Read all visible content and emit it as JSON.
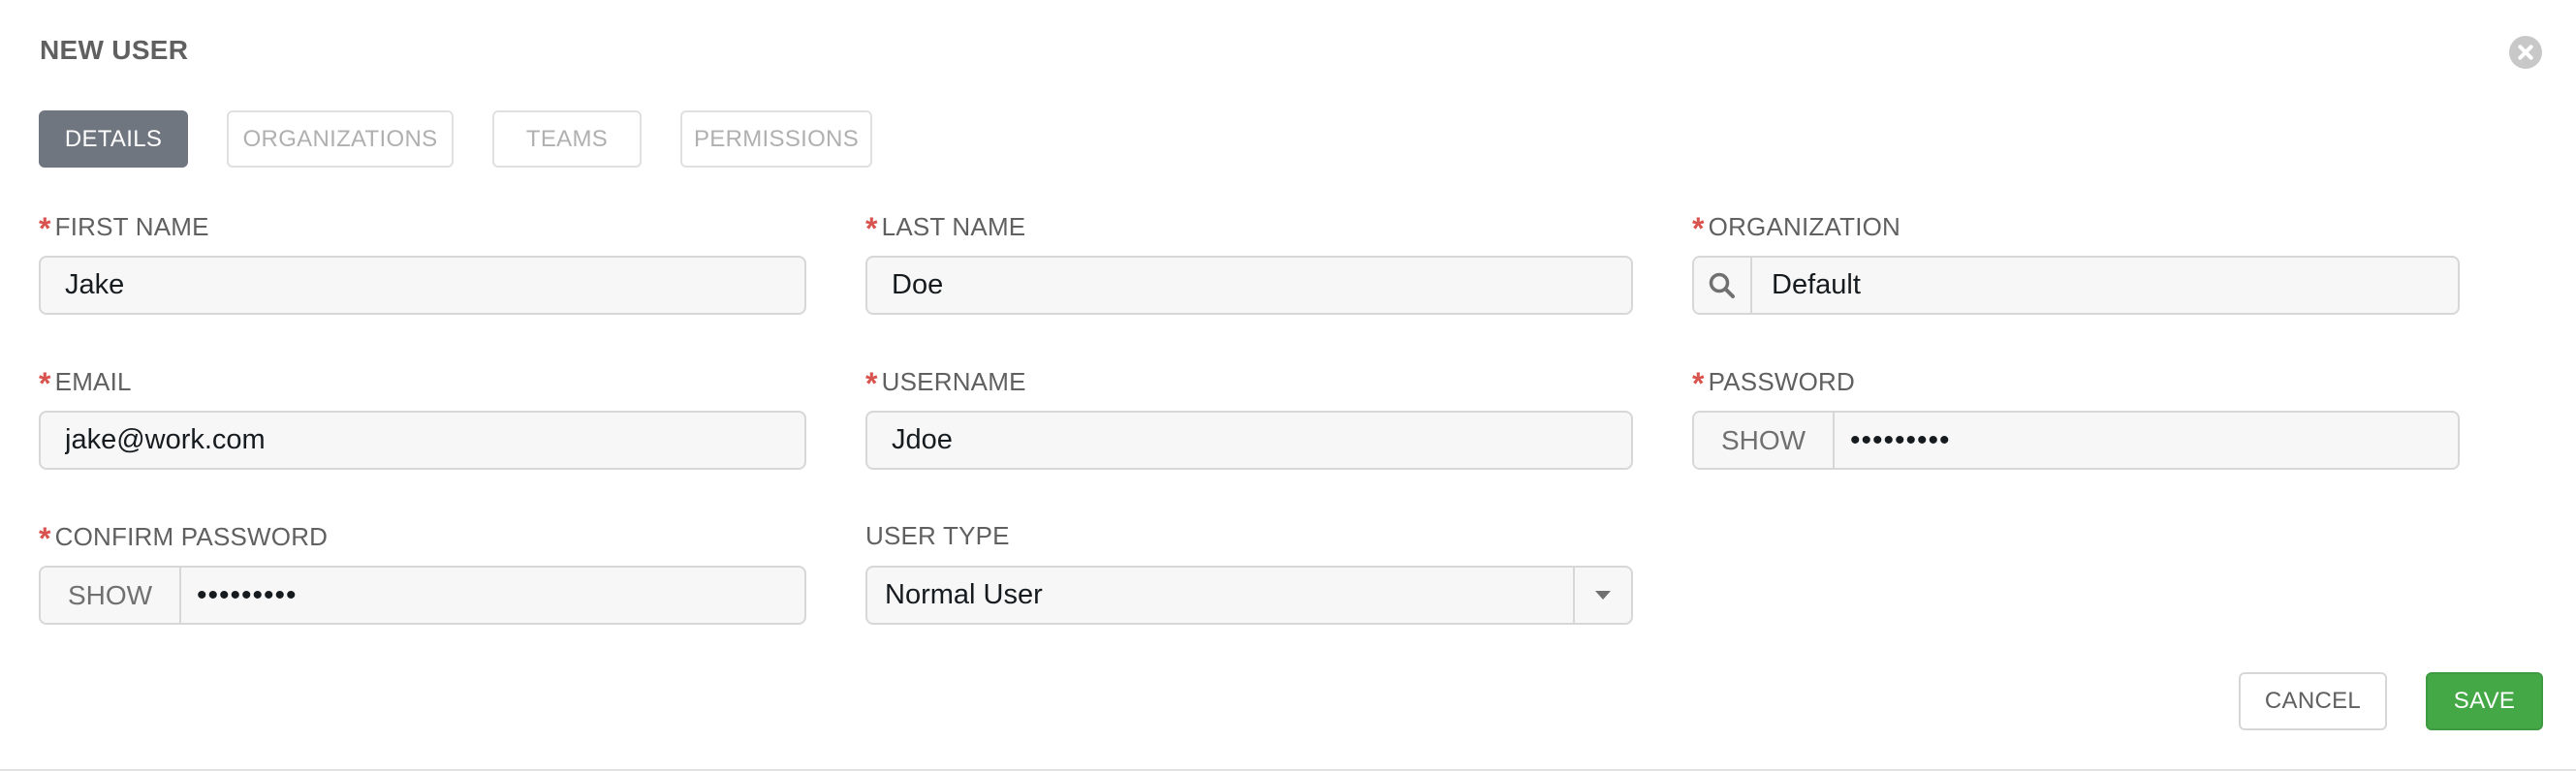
{
  "header": {
    "title": "NEW USER"
  },
  "tabs": [
    {
      "label": "DETAILS",
      "active": true
    },
    {
      "label": "ORGANIZATIONS",
      "active": false
    },
    {
      "label": "TEAMS",
      "active": false
    },
    {
      "label": "PERMISSIONS",
      "active": false
    }
  ],
  "required_marker": "*",
  "form": {
    "first_name": {
      "label": "FIRST NAME",
      "value": "Jake"
    },
    "last_name": {
      "label": "LAST NAME",
      "value": "Doe"
    },
    "organization": {
      "label": "ORGANIZATION",
      "value": "Default"
    },
    "email": {
      "label": "EMAIL",
      "value": "jake@work.com"
    },
    "username": {
      "label": "USERNAME",
      "value": "Jdoe"
    },
    "password": {
      "label": "PASSWORD",
      "value": "•••••••••",
      "show_label": "SHOW"
    },
    "confirm_password": {
      "label": "CONFIRM PASSWORD",
      "value": "•••••••••",
      "show_label": "SHOW"
    },
    "user_type": {
      "label": "USER TYPE",
      "value": "Normal User"
    }
  },
  "buttons": {
    "cancel": "CANCEL",
    "save": "SAVE"
  },
  "colors": {
    "accent_save": "#45a847",
    "required": "#d9534f",
    "active_tab": "#707680"
  },
  "icons": {
    "close": "close-circle-icon",
    "search": "search-icon",
    "dropdown": "caret-down-icon"
  }
}
